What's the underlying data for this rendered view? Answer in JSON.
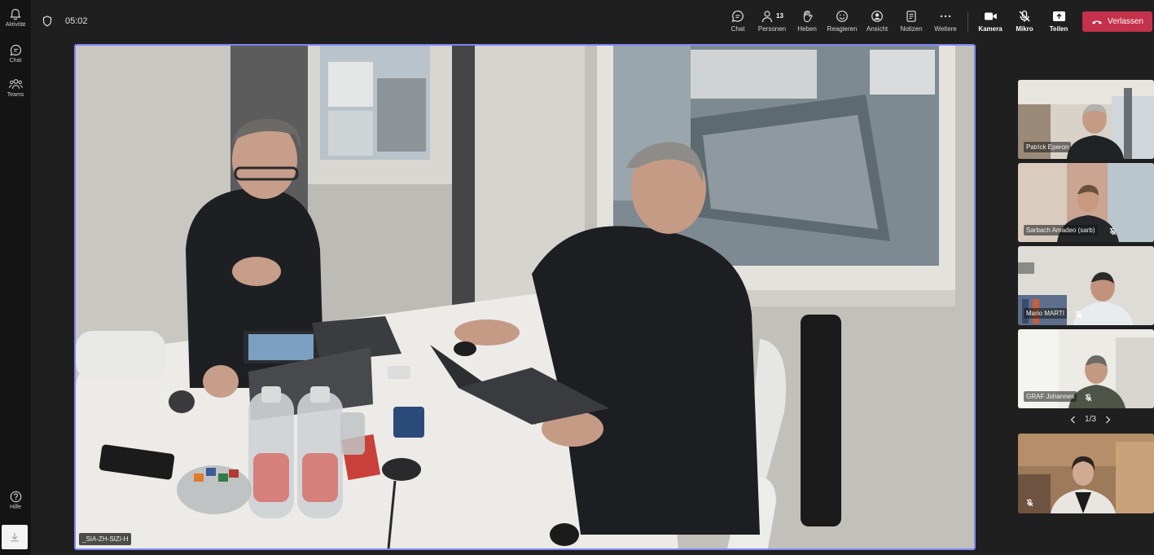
{
  "rail": {
    "items": [
      {
        "label": "Aktivität",
        "icon": "bell-icon"
      },
      {
        "label": "Chat",
        "icon": "chat-icon"
      },
      {
        "label": "Teams",
        "icon": "teams-icon"
      },
      {
        "label": "Hilfe",
        "icon": "help-icon"
      }
    ]
  },
  "meeting": {
    "elapsed": "05:02"
  },
  "toolbar": {
    "chat": "Chat",
    "people": "Personen",
    "people_count": "13",
    "raise": "Heben",
    "react": "Reagieren",
    "view": "Ansicht",
    "notes": "Notizen",
    "more": "Weitere",
    "camera": "Kamera",
    "mic": "Mikro",
    "share": "Teilen",
    "leave": "Verlassen",
    "leave_color": "#c4314b"
  },
  "main_video": {
    "name": "_SIA-ZH-SIZI-H",
    "border_color": "#7f85f5"
  },
  "participants": [
    {
      "name": "Patrick Eperon",
      "muted": false
    },
    {
      "name": "Sarbach Amadeo (sarb)",
      "muted": true
    },
    {
      "name": "Mario MARTI",
      "muted": true
    },
    {
      "name": "GRAF Johannes",
      "muted": true
    },
    {
      "name": "",
      "muted": true
    }
  ],
  "pager": {
    "label": "1/3"
  }
}
